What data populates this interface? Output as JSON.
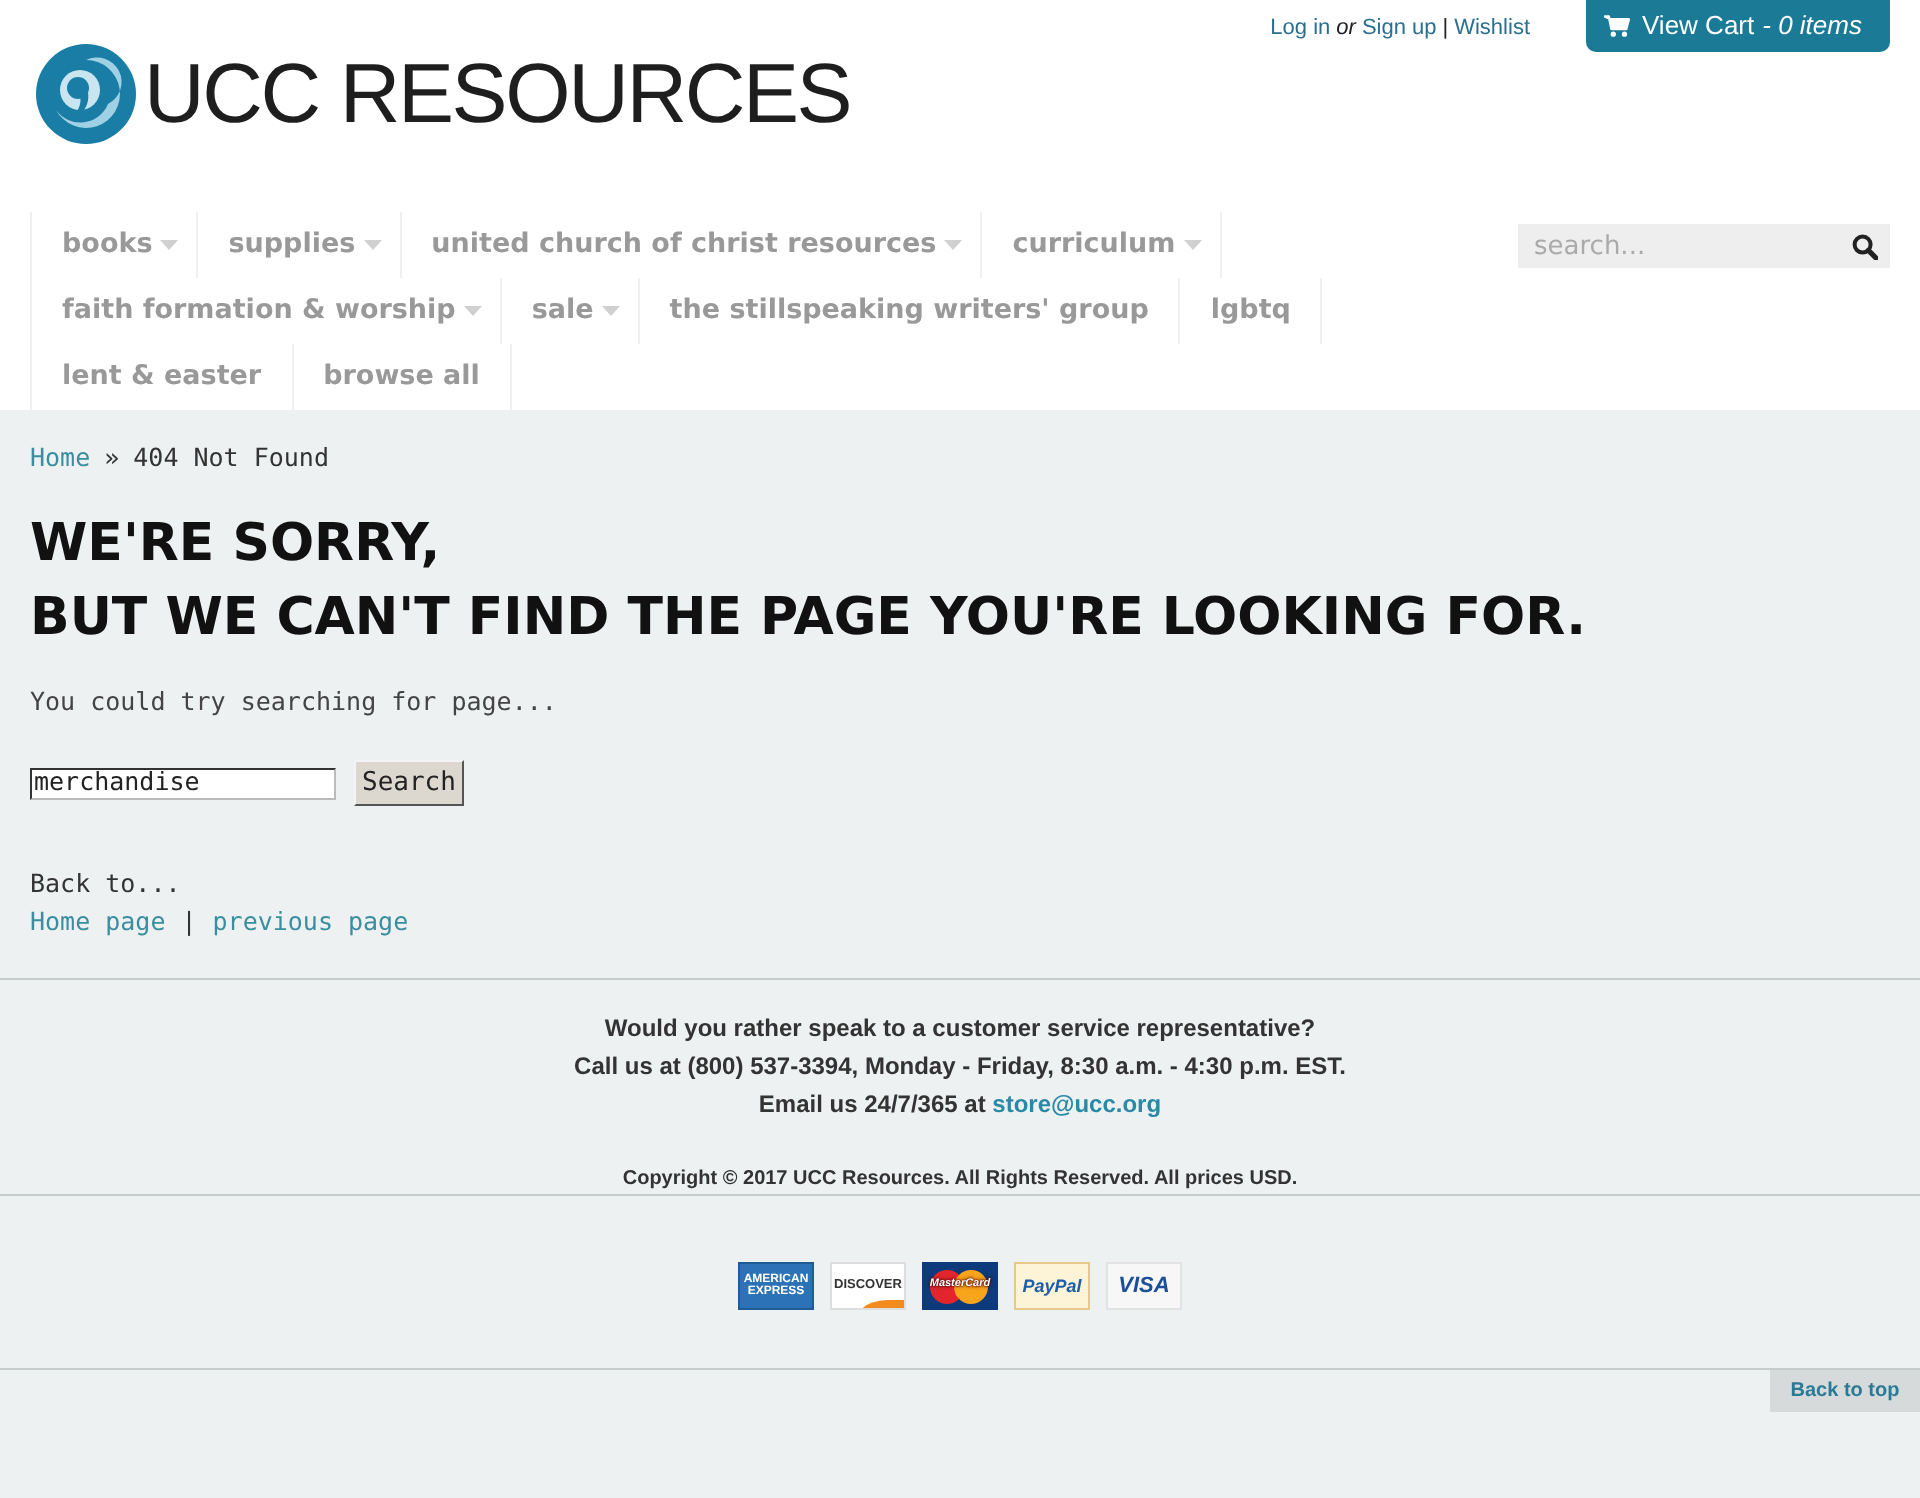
{
  "header": {
    "logo": {
      "text": "UCC RESOURCES"
    },
    "account_links": [
      {
        "kind": "link",
        "text": "Log in"
      },
      {
        "kind": "text",
        "text": "or"
      },
      {
        "kind": "link",
        "text": "Sign up"
      },
      {
        "kind": "separator",
        "text": "|"
      },
      {
        "kind": "link",
        "text": "Wishlist"
      }
    ],
    "cart": {
      "label": "View Cart",
      "count": "- 0 items"
    }
  },
  "nav": {
    "items": [
      {
        "label": "books",
        "has_submenu": true
      },
      {
        "label": "supplies",
        "has_submenu": true
      },
      {
        "label": "united church of christ resources",
        "has_submenu": true
      },
      {
        "label": "curriculum",
        "has_submenu": true
      },
      {
        "label": "faith formation & worship",
        "has_submenu": true
      },
      {
        "label": "sale",
        "has_submenu": true
      },
      {
        "label": "the stillspeaking writers' group",
        "has_submenu": false
      },
      {
        "label": "lgbtq",
        "has_submenu": false
      },
      {
        "label": "lent & easter",
        "has_submenu": false
      },
      {
        "label": "browse all",
        "has_submenu": false
      }
    ],
    "search": {
      "placeholder": "search..."
    }
  },
  "breadcrumb": {
    "items": [
      {
        "text": "Home",
        "link": true
      },
      {
        "text": "404 Not Found",
        "link": false
      }
    ],
    "separator": "»"
  },
  "heading": [
    "WE'RE SORRY,",
    "BUT WE CAN'T FIND THE PAGE YOU'RE LOOKING FOR."
  ],
  "search_prompt": "You could try searching for page...",
  "search_form": {
    "value": "merchandise",
    "button": "Search"
  },
  "back_to": {
    "label": "Back to...",
    "links": [
      "Home page",
      "previous page"
    ],
    "separator": "|"
  },
  "footer": {
    "contact": [
      {
        "text": "Would you rather speak to a customer service representative?"
      },
      {
        "text": "Call us at (800) 537-3394, Monday - Friday, 8:30 a.m. - 4:30 p.m. EST."
      },
      {
        "text": "Email us 24/7/365 at",
        "link": "store@ucc.org"
      }
    ],
    "copyright": "Copyright © 2017 UCC Resources. All Rights Reserved. All prices USD.",
    "payment_methods": [
      {
        "kind": "amex",
        "lines": [
          "AMERICAN",
          "EXPRESS"
        ]
      },
      {
        "kind": "discover",
        "lines": [
          "DISCOVER"
        ]
      },
      {
        "kind": "mastercard",
        "lines": [
          "MasterCard"
        ]
      },
      {
        "kind": "paypal",
        "lines": [
          "PayPal"
        ]
      },
      {
        "kind": "visa",
        "lines": [
          "VISA"
        ]
      }
    ],
    "back_to_top": "Back to top"
  }
}
